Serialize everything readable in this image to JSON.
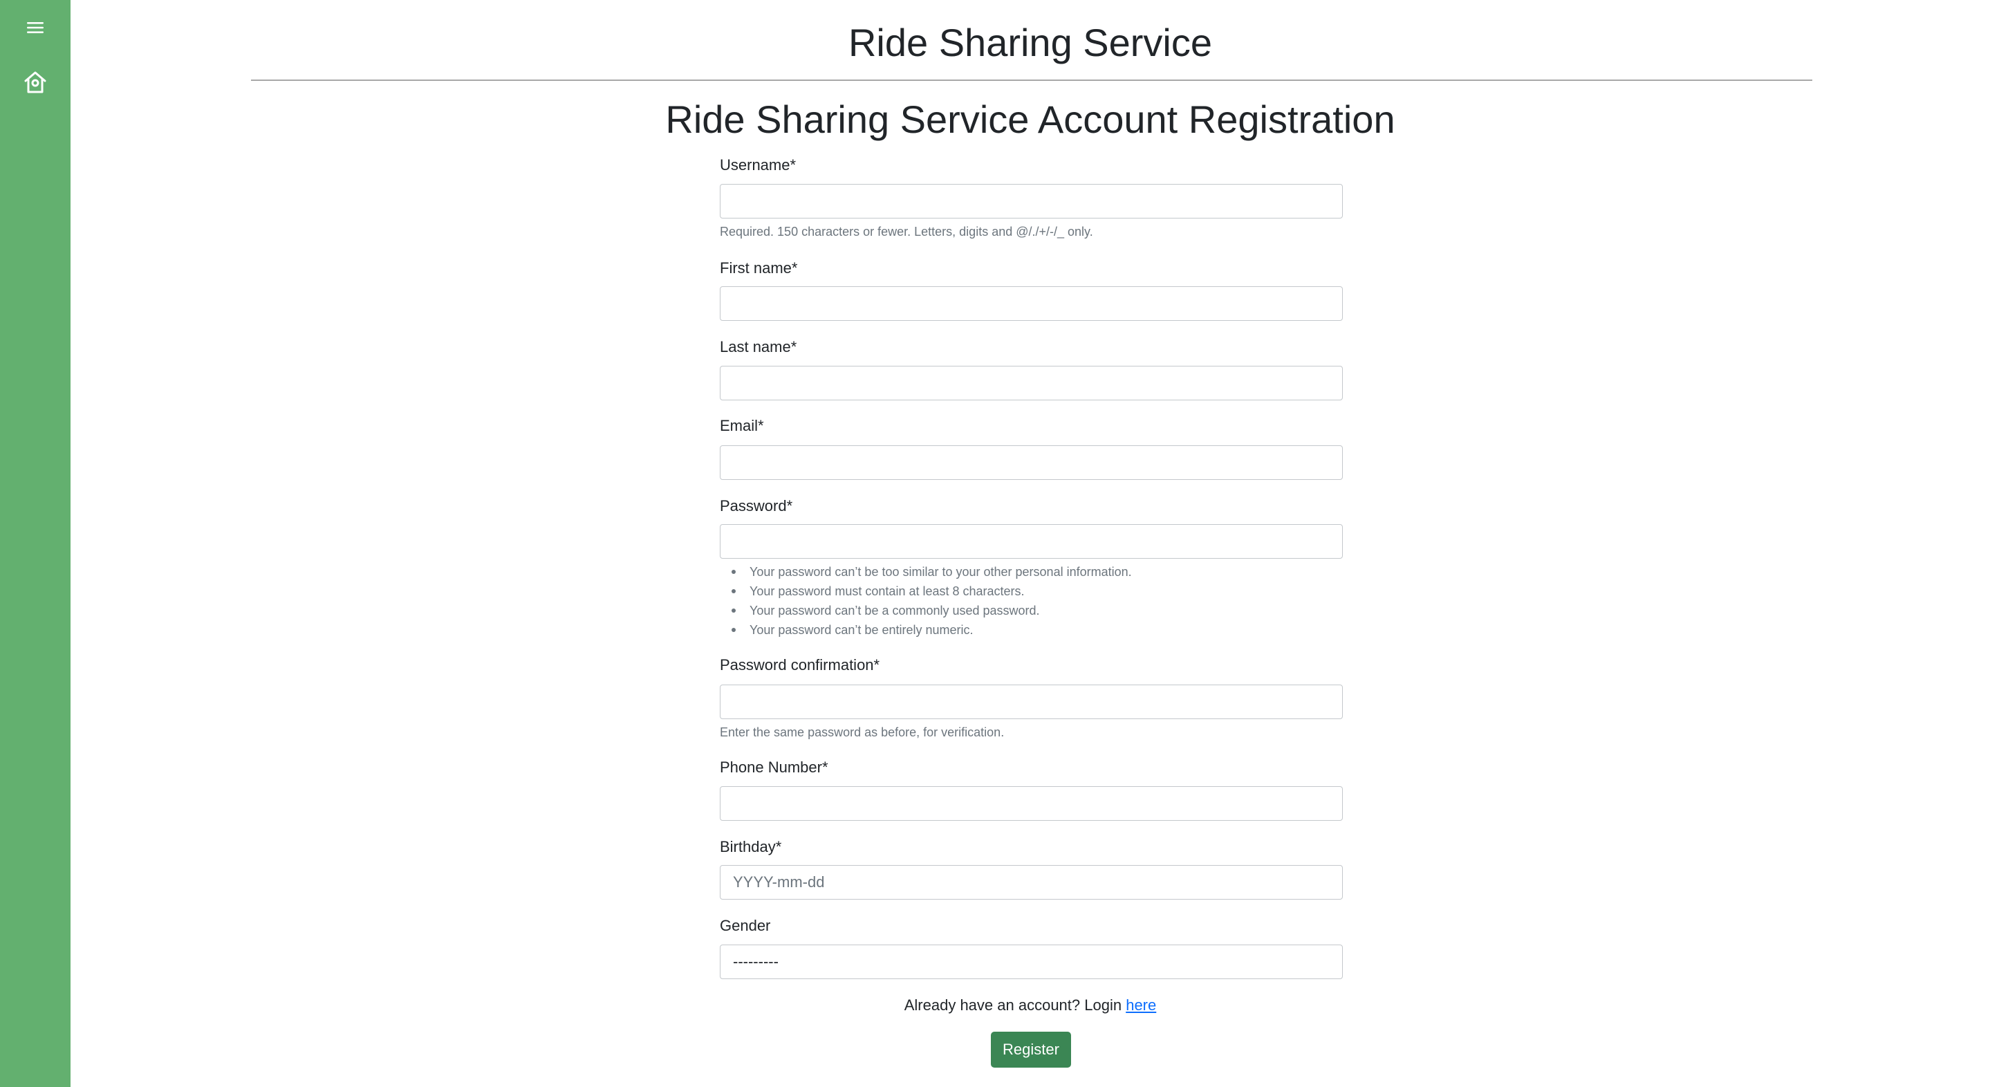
{
  "sidebar": {
    "icons": [
      "menu-icon",
      "home-icon"
    ],
    "bg_color": "#63b06f"
  },
  "header": {
    "title": "Ride Sharing Service"
  },
  "form": {
    "title": "Ride Sharing Service Account Registration",
    "fields": {
      "username": {
        "label": "Username*",
        "value": "",
        "help": "Required. 150 characters or fewer. Letters, digits and @/./+/-/_ only."
      },
      "first_name": {
        "label": "First name*",
        "value": ""
      },
      "last_name": {
        "label": "Last name*",
        "value": ""
      },
      "email": {
        "label": "Email*",
        "value": ""
      },
      "password": {
        "label": "Password*",
        "value": "",
        "help_items": [
          "Your password can’t be too similar to your other personal information.",
          "Your password must contain at least 8 characters.",
          "Your password can’t be a commonly used password.",
          "Your password can’t be entirely numeric."
        ]
      },
      "password_confirmation": {
        "label": "Password confirmation*",
        "value": "",
        "help": "Enter the same password as before, for verification."
      },
      "phone": {
        "label": "Phone Number*",
        "value": ""
      },
      "birthday": {
        "label": "Birthday*",
        "value": "",
        "placeholder": "YYYY-mm-dd"
      },
      "gender": {
        "label": "Gender",
        "selected": "---------"
      }
    },
    "login_prompt": "Already have an account? Login",
    "login_link": "here",
    "submit_label": "Register",
    "submit_color": "#3b8654"
  },
  "colors": {
    "link": "#0d6efd",
    "help_text": "#6c757d"
  }
}
